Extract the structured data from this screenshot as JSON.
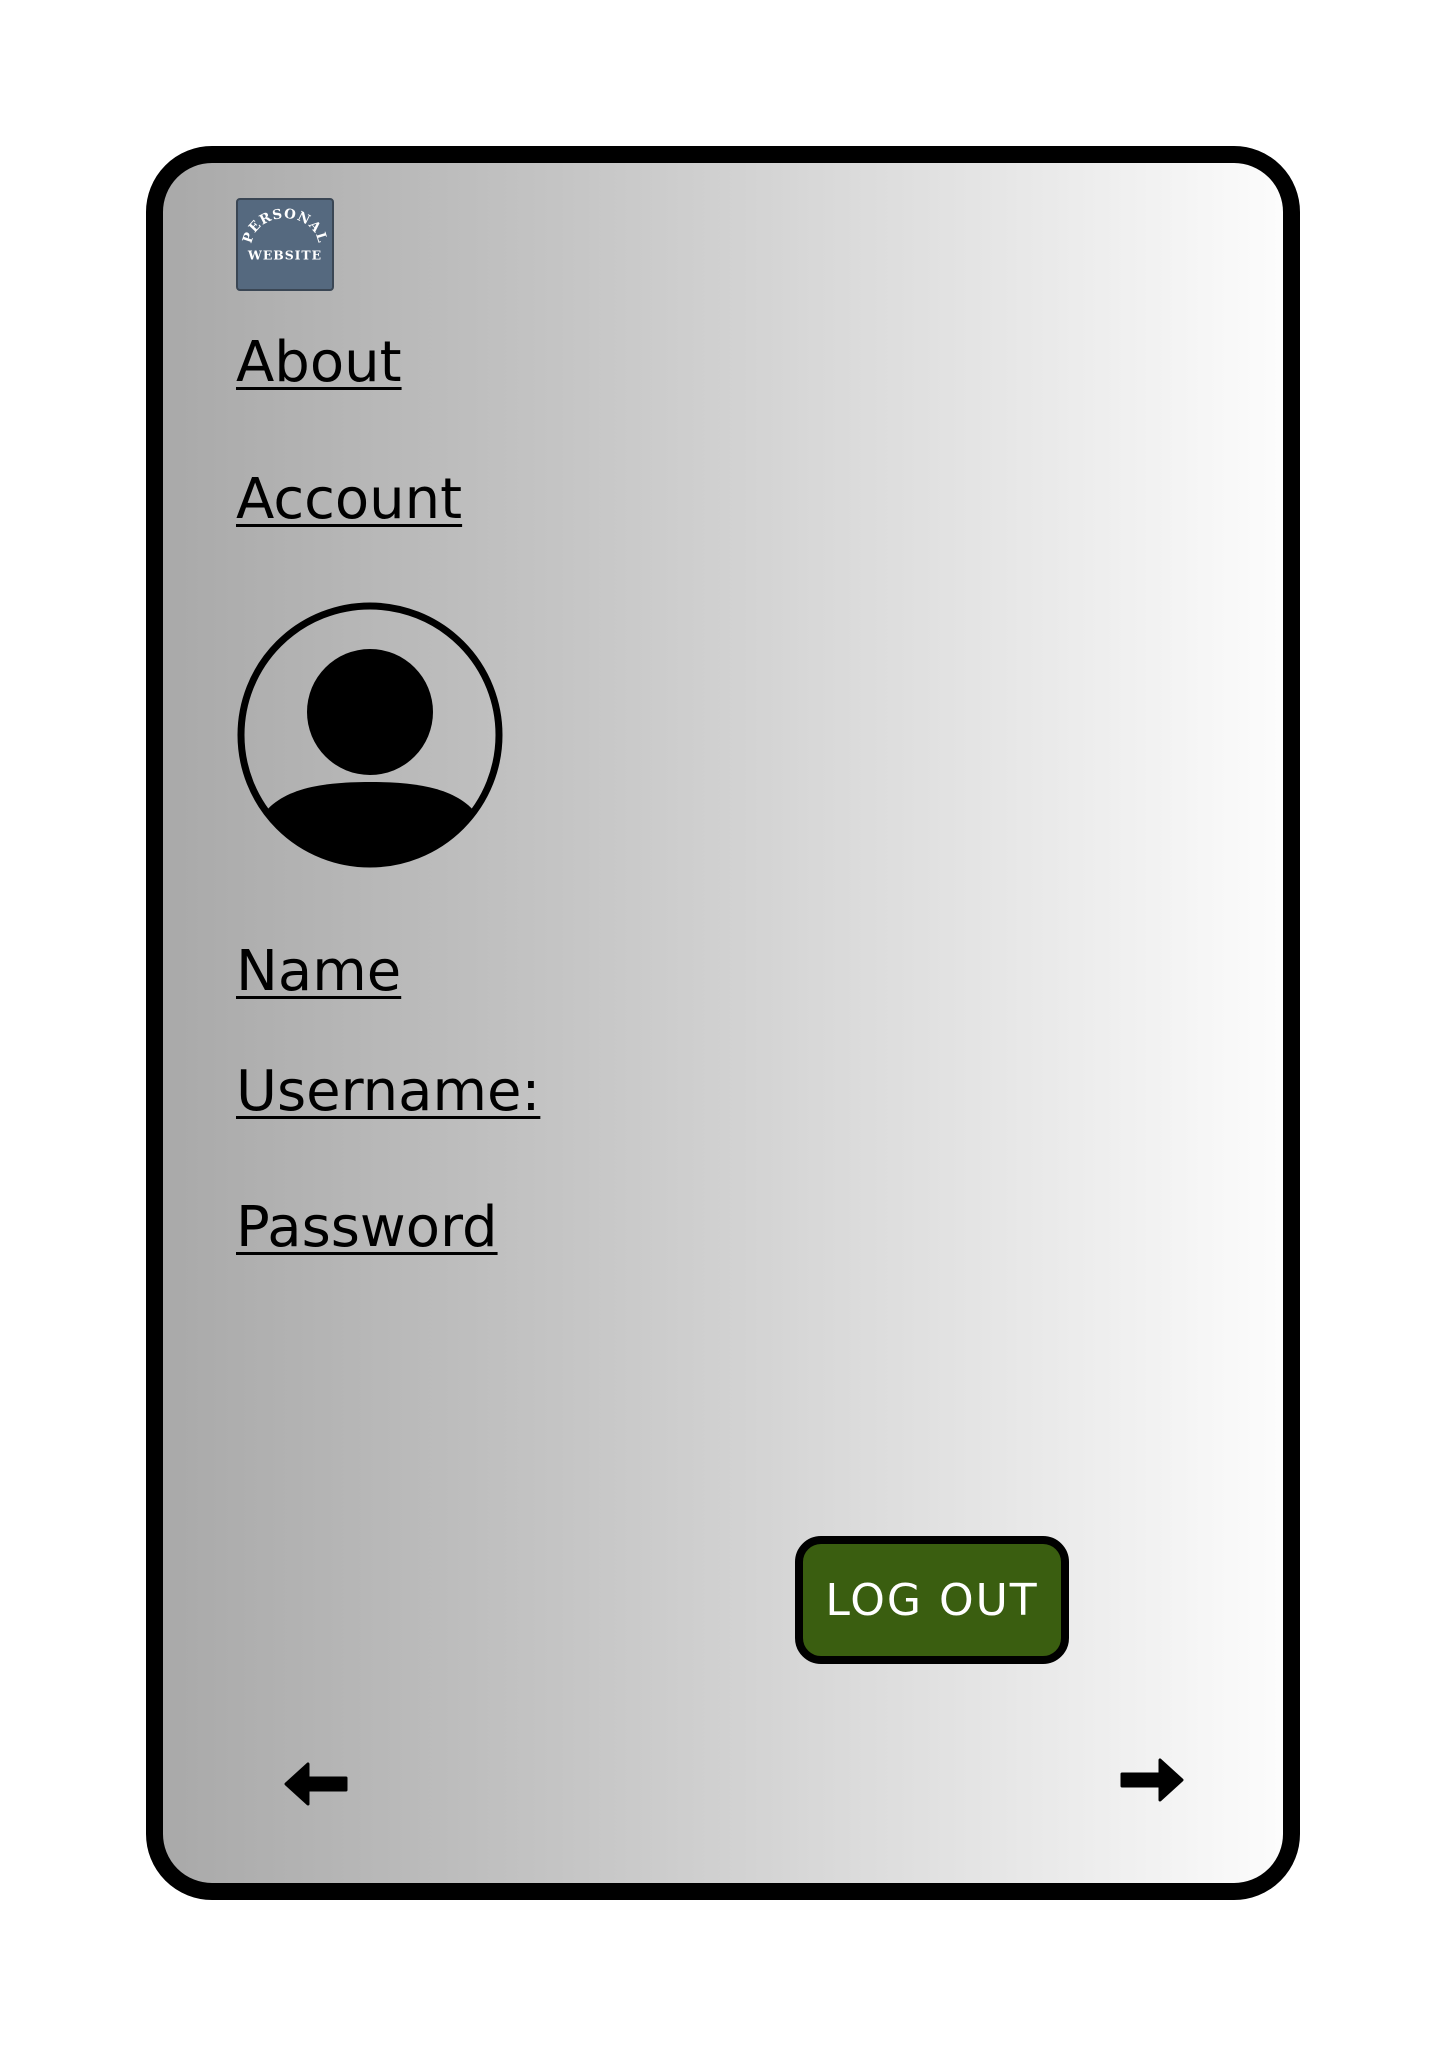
{
  "logo": {
    "line1": "PERSONAL",
    "line2": "WEBSITE",
    "icon": "personal-website-logo",
    "color": "#55697f"
  },
  "nav": {
    "about_label": "About",
    "account_label": "Account"
  },
  "profile": {
    "avatar_icon": "user-avatar-icon",
    "name_label": "Name",
    "username_label": "Username:",
    "password_label": "Password"
  },
  "actions": {
    "logout_label": "LOG OUT",
    "logout_color": "#3a5e10",
    "back_icon": "arrow-left-icon",
    "forward_icon": "arrow-right-icon"
  }
}
